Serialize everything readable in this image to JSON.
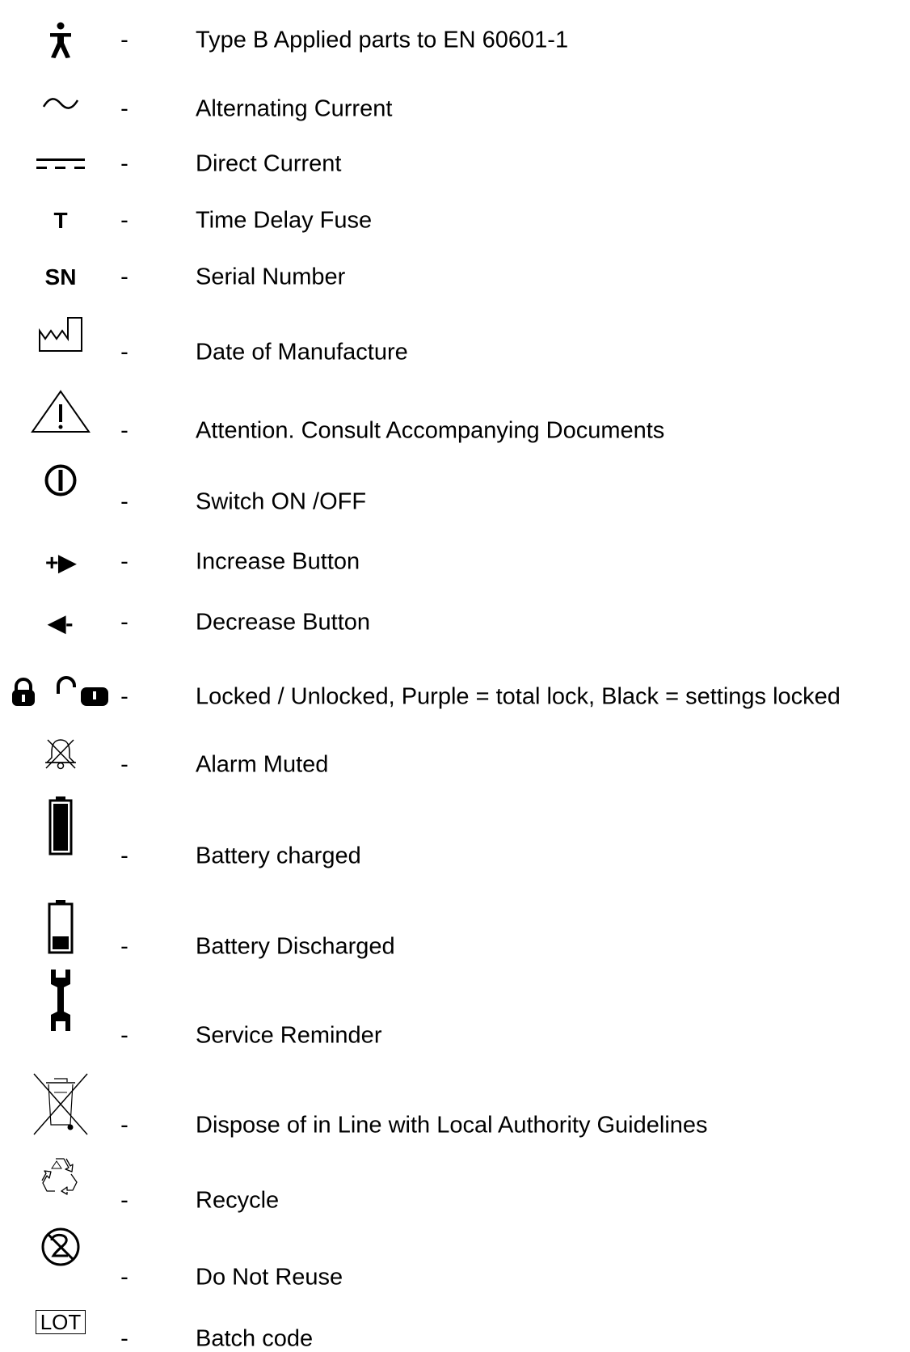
{
  "symbols": [
    {
      "icon": "type-b-applied-part-icon",
      "description": "Type B Applied parts to EN 60601-1"
    },
    {
      "icon": "alternating-current-icon",
      "description": "Alternating Current"
    },
    {
      "icon": "direct-current-icon",
      "description": "Direct Current"
    },
    {
      "icon": "time-delay-fuse-icon",
      "symbol_text": "T",
      "description": "Time Delay Fuse"
    },
    {
      "icon": "serial-number-icon",
      "symbol_text": "SN",
      "description": "Serial Number"
    },
    {
      "icon": "date-of-manufacture-icon",
      "description": "Date of Manufacture"
    },
    {
      "icon": "warning-triangle-icon",
      "description": "Attention. Consult Accompanying Documents"
    },
    {
      "icon": "power-switch-icon",
      "description": "Switch ON /OFF"
    },
    {
      "icon": "increase-button-icon",
      "symbol_text": "+▶",
      "description": "Increase Button"
    },
    {
      "icon": "decrease-button-icon",
      "symbol_text": "◀-",
      "description": "Decrease Button"
    },
    {
      "icon": "lock-unlock-icon",
      "description": "Locked / Unlocked, Purple = total lock, Black = settings locked"
    },
    {
      "icon": "alarm-muted-icon",
      "description": "Alarm Muted"
    },
    {
      "icon": "battery-charged-icon",
      "description": "Battery charged"
    },
    {
      "icon": "battery-discharged-icon",
      "description": "Battery Discharged"
    },
    {
      "icon": "wrench-icon",
      "description": "Service Reminder"
    },
    {
      "icon": "crossed-out-bin-icon",
      "description": "Dispose of in Line with Local Authority Guidelines"
    },
    {
      "icon": "recycle-icon",
      "description": "Recycle"
    },
    {
      "icon": "do-not-reuse-icon",
      "description": "Do Not Reuse"
    },
    {
      "icon": "lot-icon",
      "symbol_text": "LOT",
      "description": "Batch code"
    }
  ],
  "separator": "-",
  "colors": {
    "text": "#000000",
    "background": "#ffffff"
  }
}
